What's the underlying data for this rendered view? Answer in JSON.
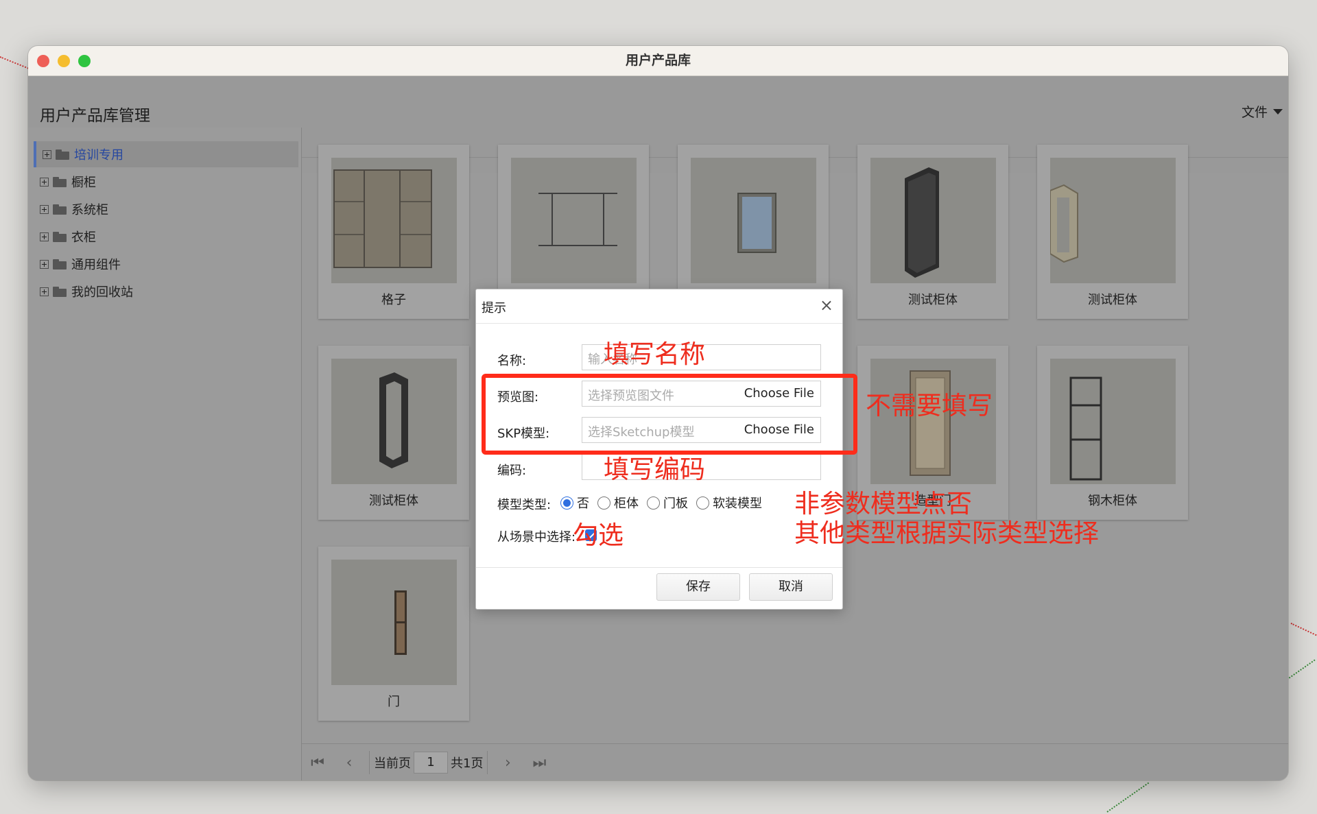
{
  "window": {
    "title": "用户产品库"
  },
  "header": {
    "title": "用户产品库管理",
    "file_menu": "文件"
  },
  "sidebar": {
    "items": [
      {
        "label": "培训专用"
      },
      {
        "label": "橱柜"
      },
      {
        "label": "系统柜"
      },
      {
        "label": "衣柜"
      },
      {
        "label": "通用组件"
      },
      {
        "label": "我的回收站"
      }
    ]
  },
  "grid": {
    "items": [
      {
        "label": "格子"
      },
      {
        "label": ""
      },
      {
        "label": ""
      },
      {
        "label": "测试柜体"
      },
      {
        "label": "测试柜体"
      },
      {
        "label": "测试柜体"
      },
      {
        "label": "造型门"
      },
      {
        "label": "钢木柜体"
      },
      {
        "label": "门"
      }
    ]
  },
  "pagination": {
    "current_label": "当前页",
    "current_page": "1",
    "total_label": "共1页"
  },
  "dialog": {
    "title": "提示",
    "close": "×",
    "name_label": "名称:",
    "name_placeholder": "输入名称",
    "preview_label": "预览图:",
    "preview_placeholder": "选择预览图文件",
    "skp_label": "SKP模型:",
    "skp_placeholder": "选择Sketchup模型",
    "choose_file": "Choose File",
    "code_label": "编码:",
    "type_label": "模型类型:",
    "type_options": [
      "否",
      "柜体",
      "门板",
      "软装模型"
    ],
    "scene_label": "从场景中选择:",
    "save": "保存",
    "cancel": "取消"
  },
  "annotations": {
    "name": "填写名称",
    "no_need": "不需要填写",
    "code": "填写编码",
    "check": "勾选",
    "type_line1": "非参数模型点否",
    "type_line2": "其他类型根据实际类型选择"
  },
  "colors": {
    "accent": "#2f6fe0",
    "annotation": "#ee2d1e",
    "selected_tree": "#2647a0"
  }
}
